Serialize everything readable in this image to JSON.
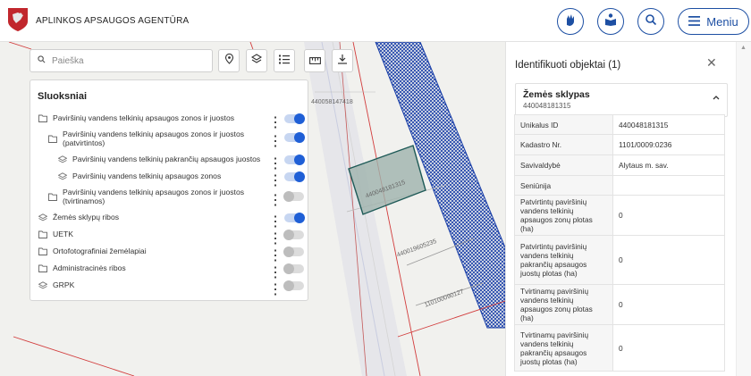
{
  "header": {
    "agency_name": "APLINKOS APSAUGOS AGENTŪRA",
    "menu_label": "Meniu",
    "colors": {
      "accent": "#1d4fa3",
      "logo_red": "#c1272d"
    }
  },
  "map": {
    "search_placeholder": "Paieška",
    "parcel_labels": [
      "440058147418",
      "440048181315",
      "440019605235",
      "110100090127"
    ],
    "colors": {
      "selected_fill": "#9fb3ad",
      "selected_stroke": "#1e5a57",
      "hatch": "#1a3fa8",
      "boundary": "#d23c3c"
    }
  },
  "layers_panel": {
    "title": "Sluoksniai",
    "items": [
      {
        "label": "Paviršinių vandens telkinių apsaugos zonos ir juostos",
        "icon": "folder-icon",
        "on": true
      },
      {
        "label": "Paviršinių vandens telkinių apsaugos zonos ir juostos",
        "label2": "(patvirtintos)",
        "icon": "folder-icon",
        "on": true
      },
      {
        "label": "Paviršinių vandens telkinių pakrančių apsaugos juostos",
        "icon": "layers-icon",
        "on": true
      },
      {
        "label": "Paviršinių vandens telkinių apsaugos zonos",
        "icon": "layers-icon",
        "on": true
      },
      {
        "label": "Paviršinių vandens telkinių apsaugos zonos ir juostos",
        "label2": "(tvirtinamos)",
        "icon": "folder-icon",
        "on": false
      },
      {
        "label": "Žemės sklypų ribos",
        "icon": "layers-icon",
        "on": true
      },
      {
        "label": "UETK",
        "icon": "folder-icon",
        "on": false
      },
      {
        "label": "Ortofotografiniai žemėlapiai",
        "icon": "folder-icon",
        "on": false
      },
      {
        "label": "Administracinės ribos",
        "icon": "folder-icon",
        "on": false
      },
      {
        "label": "GRPK",
        "icon": "layers-icon",
        "on": false
      }
    ]
  },
  "identify_panel": {
    "title": "Identifikuoti objektai (1)",
    "card_title": "Žemės sklypas",
    "card_subtitle": "440048181315",
    "rows": [
      {
        "key": "Unikalus ID",
        "value": "440048181315"
      },
      {
        "key": "Kadastro Nr.",
        "value": "1101/0009:0236"
      },
      {
        "key": "Savivaldybė",
        "value": "Alytaus m. sav."
      },
      {
        "key": "Seniūnija",
        "value": ""
      },
      {
        "key": "Patvirtintų paviršinių vandens telkinių apsaugos zonų plotas (ha)",
        "value": "0"
      },
      {
        "key": "Patvirtintų paviršinių vandens telkinių pakrančių apsaugos juostų plotas (ha)",
        "value": "0"
      },
      {
        "key": "Tvirtinamų paviršinių vandens telkinių apsaugos zonų plotas (ha)",
        "value": "0"
      },
      {
        "key": "Tvirtinamų paviršinių vandens telkinių pakrančių apsaugos juostų plotas (ha)",
        "value": "0"
      }
    ]
  }
}
